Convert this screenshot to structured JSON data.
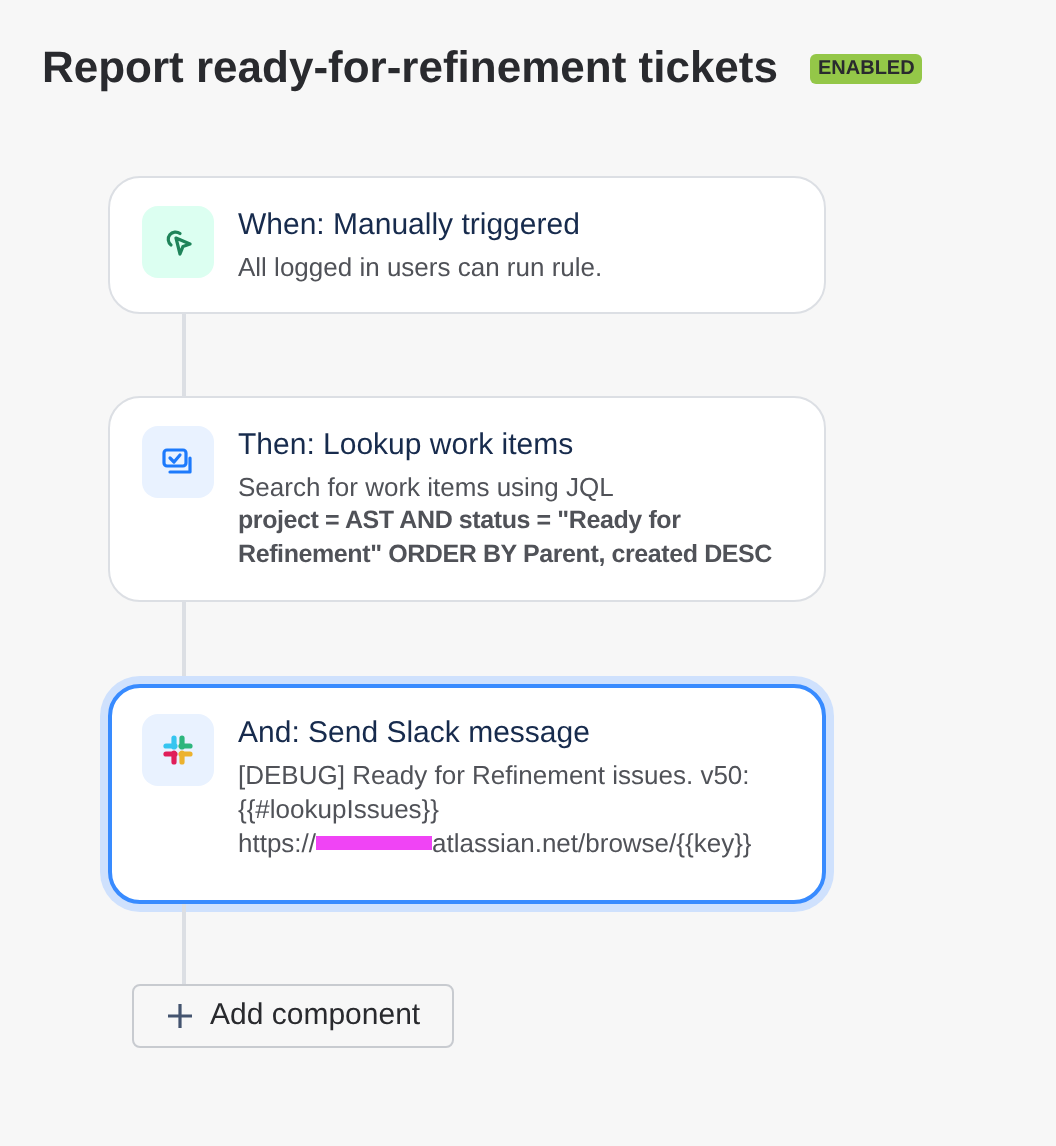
{
  "title": "Report ready-for-refinement tickets",
  "status_badge": {
    "label": "ENABLED",
    "enabled": true
  },
  "steps": [
    {
      "kind": "trigger",
      "title": "When: Manually triggered",
      "selected": false,
      "lines": [
        {
          "kind": "plain",
          "text": "All logged in users can run rule."
        }
      ]
    },
    {
      "kind": "lookup",
      "title": "Then: Lookup work items",
      "selected": false,
      "lines": [
        {
          "kind": "plain",
          "text": "Search for work items using JQL"
        },
        {
          "kind": "bold",
          "text": "project = AST AND status = \"Ready for Refinement\" ORDER BY Parent, created DESC"
        }
      ]
    },
    {
      "kind": "slack",
      "title": "And: Send Slack message",
      "selected": true,
      "lines": [
        {
          "kind": "plain",
          "text": "[DEBUG] Ready for Refinement issues. v50:"
        },
        {
          "kind": "plain",
          "text": "{{#lookupIssues}}"
        },
        {
          "kind": "redacted",
          "prefix": "https://",
          "suffix": "atlassian.net/browse/{{key}}"
        }
      ]
    }
  ],
  "add_button": {
    "label": "Add component"
  }
}
